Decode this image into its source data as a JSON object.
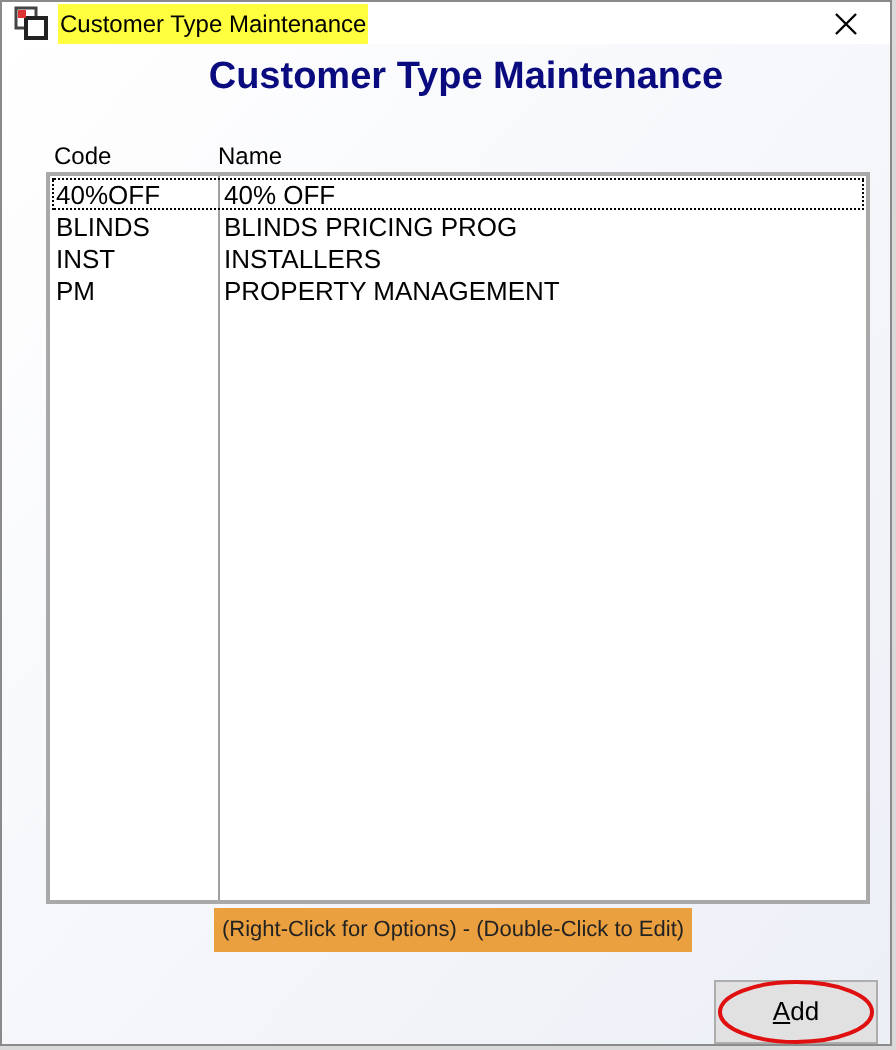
{
  "window": {
    "title": "Customer Type Maintenance",
    "title_highlighted": true
  },
  "heading": "Customer Type Maintenance",
  "table": {
    "columns": [
      "Code",
      "Name"
    ],
    "rows": [
      {
        "code": "40%OFF",
        "name": "40% OFF",
        "selected": true
      },
      {
        "code": "BLINDS",
        "name": "BLINDS PRICING PROG",
        "selected": false
      },
      {
        "code": "INST",
        "name": "INSTALLERS",
        "selected": false
      },
      {
        "code": "PM",
        "name": "PROPERTY MANAGEMENT",
        "selected": false
      }
    ]
  },
  "hint": "(Right-Click for Options) - (Double-Click to Edit)",
  "buttons": [
    {
      "label_parts": [
        {
          "text": "A",
          "underlined": true
        },
        {
          "text": "dd",
          "underlined": false
        }
      ],
      "circled": true
    }
  ]
}
